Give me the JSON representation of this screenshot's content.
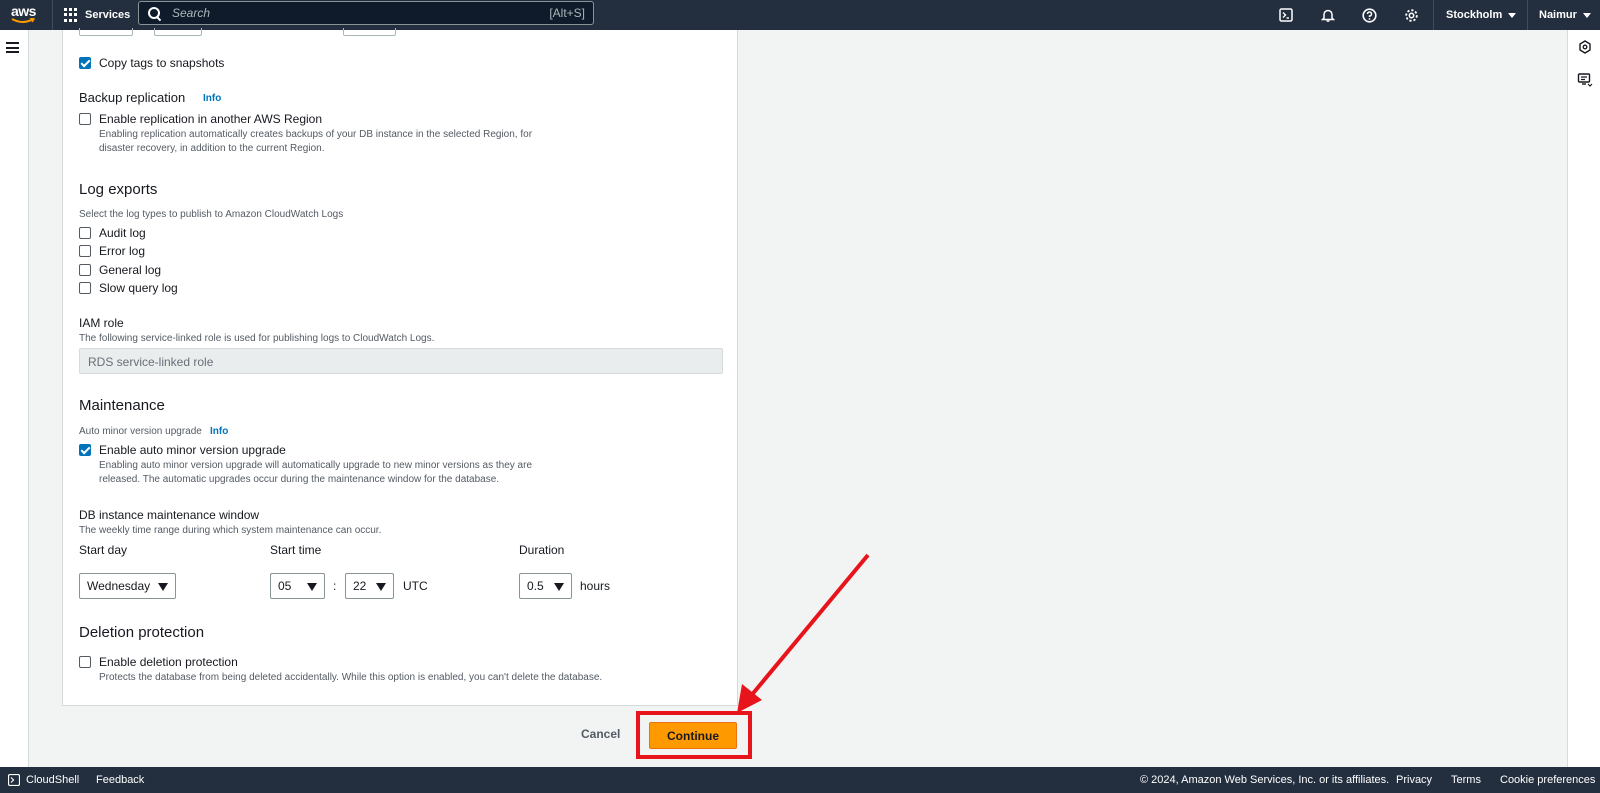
{
  "nav": {
    "logo_text": "aws",
    "services_label": "Services",
    "search_placeholder": "Search",
    "search_shortcut": "[Alt+S]",
    "region_label": "Stockholm",
    "user_label": "Naimur"
  },
  "content": {
    "copy_tags_label": "Copy tags to snapshots",
    "backup_replication": {
      "title": "Backup replication",
      "info": "Info",
      "checkbox_label": "Enable replication in another AWS Region",
      "description": "Enabling replication automatically creates backups of your DB instance in the selected Region, for disaster recovery, in addition to the current Region."
    },
    "log_exports": {
      "title": "Log exports",
      "subtitle": "Select the log types to publish to Amazon CloudWatch Logs",
      "items": [
        "Audit log",
        "Error log",
        "General log",
        "Slow query log"
      ]
    },
    "iam_role": {
      "title": "IAM role",
      "subtitle": "The following service-linked role is used for publishing logs to CloudWatch Logs.",
      "value": "RDS service-linked role"
    },
    "maintenance": {
      "title": "Maintenance",
      "auto_minor_label": "Auto minor version upgrade",
      "info": "Info",
      "checkbox_label": "Enable auto minor version upgrade",
      "description": "Enabling auto minor version upgrade will automatically upgrade to new minor versions as they are released. The automatic upgrades occur during the maintenance window for the database."
    },
    "window": {
      "title": "DB instance maintenance window",
      "subtitle": "The weekly time range during which system maintenance can occur.",
      "start_day_label": "Start day",
      "start_day_value": "Wednesday",
      "start_time_label": "Start time",
      "start_hour": "05",
      "time_separator": ":",
      "start_minute": "22",
      "tz": "UTC",
      "duration_label": "Duration",
      "duration_value": "0.5",
      "duration_unit": "hours"
    },
    "deletion_protection": {
      "title": "Deletion protection",
      "checkbox_label": "Enable deletion protection",
      "description": "Protects the database from being deleted accidentally. While this option is enabled, you can't delete the database."
    }
  },
  "actions": {
    "cancel_label": "Cancel",
    "continue_label": "Continue"
  },
  "footer": {
    "cloudshell": "CloudShell",
    "feedback": "Feedback",
    "copyright": "© 2024, Amazon Web Services, Inc. or its affiliates.",
    "privacy": "Privacy",
    "terms": "Terms",
    "cookie": "Cookie preferences"
  },
  "colors": {
    "nav_bg": "#232f3e",
    "accent_blue": "#0073bb",
    "primary_orange": "#ff9900",
    "annotation_red": "#e8141b"
  }
}
